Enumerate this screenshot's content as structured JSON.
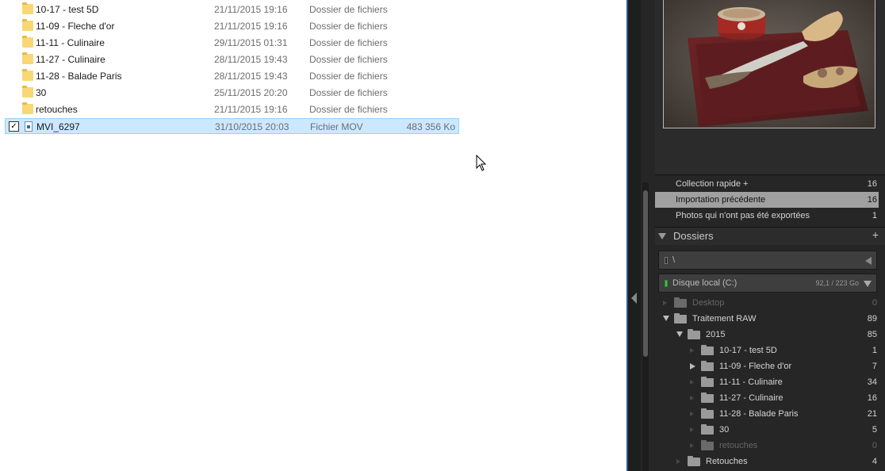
{
  "explorer": {
    "rows": [
      {
        "name": "10-17 - test 5D",
        "date": "21/11/2015 19:16",
        "type": "Dossier de fichiers",
        "size": "",
        "kind": "folder"
      },
      {
        "name": "11-09 - Fleche d'or",
        "date": "21/11/2015 19:16",
        "type": "Dossier de fichiers",
        "size": "",
        "kind": "folder"
      },
      {
        "name": "11-11 - Culinaire",
        "date": "29/11/2015 01:31",
        "type": "Dossier de fichiers",
        "size": "",
        "kind": "folder"
      },
      {
        "name": "11-27 - Culinaire",
        "date": "28/11/2015 19:43",
        "type": "Dossier de fichiers",
        "size": "",
        "kind": "folder"
      },
      {
        "name": "11-28 - Balade Paris",
        "date": "28/11/2015 19:43",
        "type": "Dossier de fichiers",
        "size": "",
        "kind": "folder"
      },
      {
        "name": "30",
        "date": "25/11/2015 20:20",
        "type": "Dossier de fichiers",
        "size": "",
        "kind": "folder"
      },
      {
        "name": "retouches",
        "date": "21/11/2015 19:16",
        "type": "Dossier de fichiers",
        "size": "",
        "kind": "folder"
      },
      {
        "name": "MVI_6297",
        "date": "31/10/2015 20:03",
        "type": "Fichier MOV",
        "size": "483 356 Ko",
        "kind": "file",
        "selected": true,
        "checked": true
      }
    ],
    "checkmark": "✓"
  },
  "lightroom": {
    "collections": [
      {
        "label": "Collection rapide +",
        "count": "16"
      },
      {
        "label": "Importation précédente",
        "count": "16",
        "highlight": true
      },
      {
        "label": "Photos qui n'ont pas été exportées",
        "count": "1"
      }
    ],
    "folders_panel": {
      "title": "Dossiers",
      "add_symbol": "+",
      "path_label": "\\",
      "volume_label": "Disque local (C:)",
      "volume_size": "92,1 / 223 Go"
    },
    "tree": [
      {
        "label": "Desktop",
        "count": "0",
        "depth": 0,
        "disc": "faint",
        "dim": true
      },
      {
        "label": "Traitement RAW",
        "count": "89",
        "depth": 0,
        "disc": "open"
      },
      {
        "label": "2015",
        "count": "85",
        "depth": 1,
        "disc": "open"
      },
      {
        "label": "10-17 - test 5D",
        "count": "1",
        "depth": 2,
        "disc": "faint"
      },
      {
        "label": "11-09 - Fleche d'or",
        "count": "7",
        "depth": 2,
        "disc": "closed"
      },
      {
        "label": "11-11 - Culinaire",
        "count": "34",
        "depth": 2,
        "disc": "faint"
      },
      {
        "label": "11-27 - Culinaire",
        "count": "16",
        "depth": 2,
        "disc": "faint"
      },
      {
        "label": "11-28 - Balade Paris",
        "count": "21",
        "depth": 2,
        "disc": "faint"
      },
      {
        "label": "30",
        "count": "5",
        "depth": 2,
        "disc": "faint"
      },
      {
        "label": "retouches",
        "count": "0",
        "depth": 2,
        "disc": "faint",
        "dim": true
      },
      {
        "label": "Retouches",
        "count": "4",
        "depth": 1,
        "disc": "faint"
      }
    ]
  },
  "colors": {
    "selection_bg": "#cce8ff",
    "selection_border": "#99d1ff",
    "lr_bg": "#262626",
    "highlight_row": "#a0a0a0",
    "folder_yellow": "#f8d775"
  }
}
